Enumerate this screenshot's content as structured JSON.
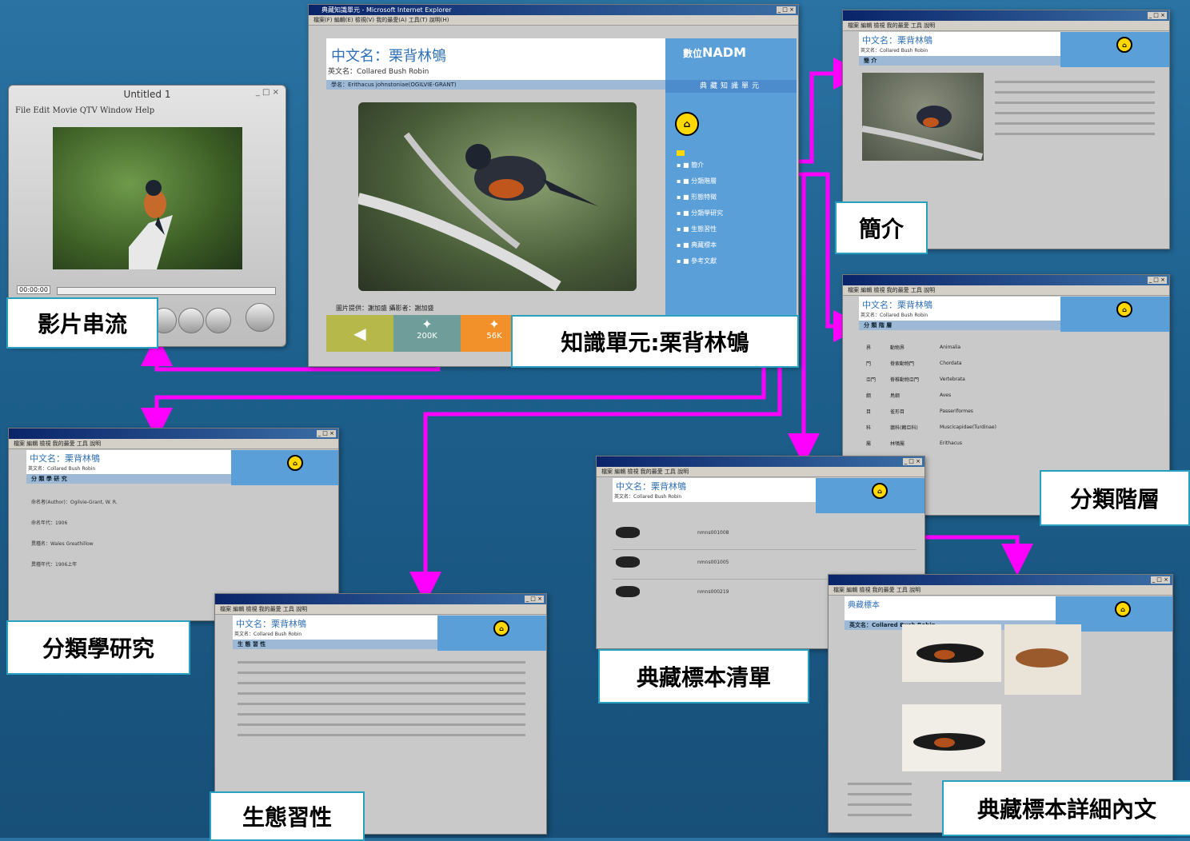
{
  "labels": {
    "video": "影片串流",
    "knowledge": "知識單元:栗背林鴝",
    "intro": "簡介",
    "hierarchy": "分類階層",
    "taxonomy": "分類學研究",
    "ecology": "生態習性",
    "specimen_list": "典藏標本清單",
    "specimen_detail": "典藏標本詳細內文"
  },
  "player": {
    "title": "Untitled 1",
    "menu": "File  Edit  Movie  QTV  Window  Help",
    "timecode": "00:00:00"
  },
  "main_window": {
    "title": "典藏知識單元 - Microsoft Internet Explorer",
    "cn_name": "中文名：栗背林鴝",
    "en_name": "英文名：Collared Bush Robin",
    "sci_name": "學名：Erithacus johnstoniae(OGILVIE-GRANT)",
    "logo": "NADM",
    "logo_small": "數位",
    "unit_label": "典藏知識單元",
    "nav": [
      "簡介",
      "分類階層",
      "形態特徵",
      "分類學研究",
      "生態習性",
      "典藏標本",
      "參考文獻"
    ],
    "credit": "圖片提供：謝加盛  攝影者：謝加盛",
    "buttons": [
      "200K",
      "56K"
    ]
  },
  "sub_windows": {
    "cn_name": "中文名：栗背林鴝",
    "en_name": "英文名：Collared Bush Robin",
    "intro_bar": "簡 介",
    "hierarchy_bar": "分 類 階 層",
    "taxonomy_bar": "分 類 學 研 究",
    "ecology_bar": "生 態 習 性",
    "specimen_detail_title": "典藏標本",
    "specimen_detail_bar": "英文名：Collared Bush Robin",
    "hierarchy_rows": [
      [
        "界",
        "動物界",
        "Animalia"
      ],
      [
        "門",
        "脊索動物門",
        "Chordata"
      ],
      [
        "亞門",
        "脊椎動物亞門",
        "Vertebrata"
      ],
      [
        "綱",
        "鳥綱",
        "Aves"
      ],
      [
        "目",
        "雀形目",
        "Passeriformes"
      ],
      [
        "科",
        "鶲科(鶇亞科)",
        "Muscicapidae(Turdinae)"
      ],
      [
        "屬",
        "林鴝屬",
        "Erithacus"
      ]
    ],
    "taxonomy_lines": [
      "命名者(Author)：Ogilvie-Grant, W. R.",
      "命名年代：1906",
      "異種名：Wales Greathillow",
      "異種年代：1906上年"
    ],
    "specimen_ids": [
      "nmns001008",
      "nmns001005",
      "nmns000219"
    ]
  },
  "colors": {
    "arrow": "#ff00ff",
    "label_border": "#2aa0c0",
    "panel_blue": "#5b9fd9"
  }
}
